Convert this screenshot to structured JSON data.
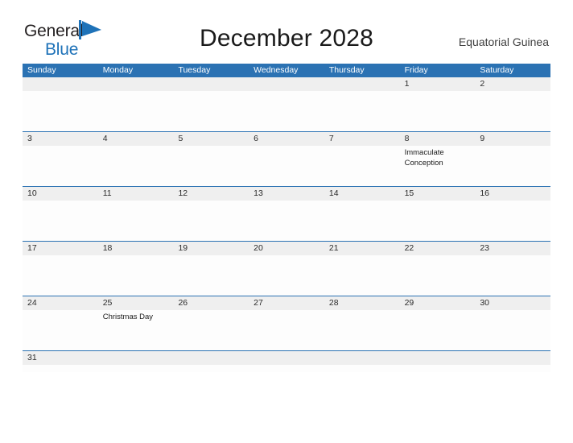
{
  "brand": {
    "word_one": "General",
    "word_two": "Blue",
    "flag_icon": "blue-flag-icon",
    "color_dark": "#231f20",
    "color_blue": "#1e72b8"
  },
  "header": {
    "title": "December 2028",
    "region": "Equatorial Guinea"
  },
  "theme": {
    "header_blue": "#2b72b3",
    "daynum_band": "#efefef",
    "cell_background": "#fdfdfd",
    "text_dark": "#2b2b2b"
  },
  "calendar": {
    "month": "December",
    "year": "2028",
    "weekday_headers": [
      "Sunday",
      "Monday",
      "Tuesday",
      "Wednesday",
      "Thursday",
      "Friday",
      "Saturday"
    ],
    "weeks": [
      {
        "days": [
          {
            "number": "",
            "events": []
          },
          {
            "number": "",
            "events": []
          },
          {
            "number": "",
            "events": []
          },
          {
            "number": "",
            "events": []
          },
          {
            "number": "",
            "events": []
          },
          {
            "number": "1",
            "events": []
          },
          {
            "number": "2",
            "events": []
          }
        ]
      },
      {
        "days": [
          {
            "number": "3",
            "events": []
          },
          {
            "number": "4",
            "events": []
          },
          {
            "number": "5",
            "events": []
          },
          {
            "number": "6",
            "events": []
          },
          {
            "number": "7",
            "events": []
          },
          {
            "number": "8",
            "events": [
              "Immaculate Conception"
            ]
          },
          {
            "number": "9",
            "events": []
          }
        ]
      },
      {
        "days": [
          {
            "number": "10",
            "events": []
          },
          {
            "number": "11",
            "events": []
          },
          {
            "number": "12",
            "events": []
          },
          {
            "number": "13",
            "events": []
          },
          {
            "number": "14",
            "events": []
          },
          {
            "number": "15",
            "events": []
          },
          {
            "number": "16",
            "events": []
          }
        ]
      },
      {
        "days": [
          {
            "number": "17",
            "events": []
          },
          {
            "number": "18",
            "events": []
          },
          {
            "number": "19",
            "events": []
          },
          {
            "number": "20",
            "events": []
          },
          {
            "number": "21",
            "events": []
          },
          {
            "number": "22",
            "events": []
          },
          {
            "number": "23",
            "events": []
          }
        ]
      },
      {
        "days": [
          {
            "number": "24",
            "events": []
          },
          {
            "number": "25",
            "events": [
              "Christmas Day"
            ]
          },
          {
            "number": "26",
            "events": []
          },
          {
            "number": "27",
            "events": []
          },
          {
            "number": "28",
            "events": []
          },
          {
            "number": "29",
            "events": []
          },
          {
            "number": "30",
            "events": []
          }
        ]
      },
      {
        "short": true,
        "days": [
          {
            "number": "31",
            "events": []
          },
          {
            "number": "",
            "events": []
          },
          {
            "number": "",
            "events": []
          },
          {
            "number": "",
            "events": []
          },
          {
            "number": "",
            "events": []
          },
          {
            "number": "",
            "events": []
          },
          {
            "number": "",
            "events": []
          }
        ]
      }
    ]
  }
}
